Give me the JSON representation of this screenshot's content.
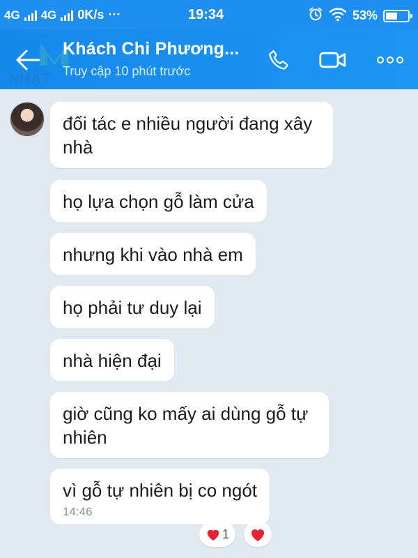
{
  "status_bar": {
    "net1": "4G",
    "net2": "4G",
    "speed": "0K/s",
    "dots": "···",
    "time": "19:34",
    "battery": "53%",
    "battery_level": 0.53
  },
  "header": {
    "title": "Khách Chi Phương...",
    "subtitle": "Truy cập 10 phút trước",
    "watermark": "NHẬT"
  },
  "messages": [
    {
      "text": "đối tác e nhiều người đang xây nhà"
    },
    {
      "text": "họ lựa chọn gỗ làm cửa"
    },
    {
      "text": "nhưng khi vào nhà em"
    },
    {
      "text": "họ phải tư duy lại"
    },
    {
      "text": "nhà hiện đại"
    },
    {
      "text": "giờ cũng ko mấy ai dùng gỗ tự nhiên"
    },
    {
      "text": "vì gỗ tự nhiên bị co ngót",
      "time": "14:46"
    }
  ],
  "reactions": {
    "heart_count": "1"
  },
  "colors": {
    "header": "#1e8ef0",
    "background": "#e1e9f2",
    "heart": "#e8232f"
  },
  "icons": [
    "back-arrow-icon",
    "phone-icon",
    "video-call-icon",
    "more-icon",
    "alarm-icon",
    "wifi-icon",
    "battery-icon",
    "heart-icon"
  ]
}
